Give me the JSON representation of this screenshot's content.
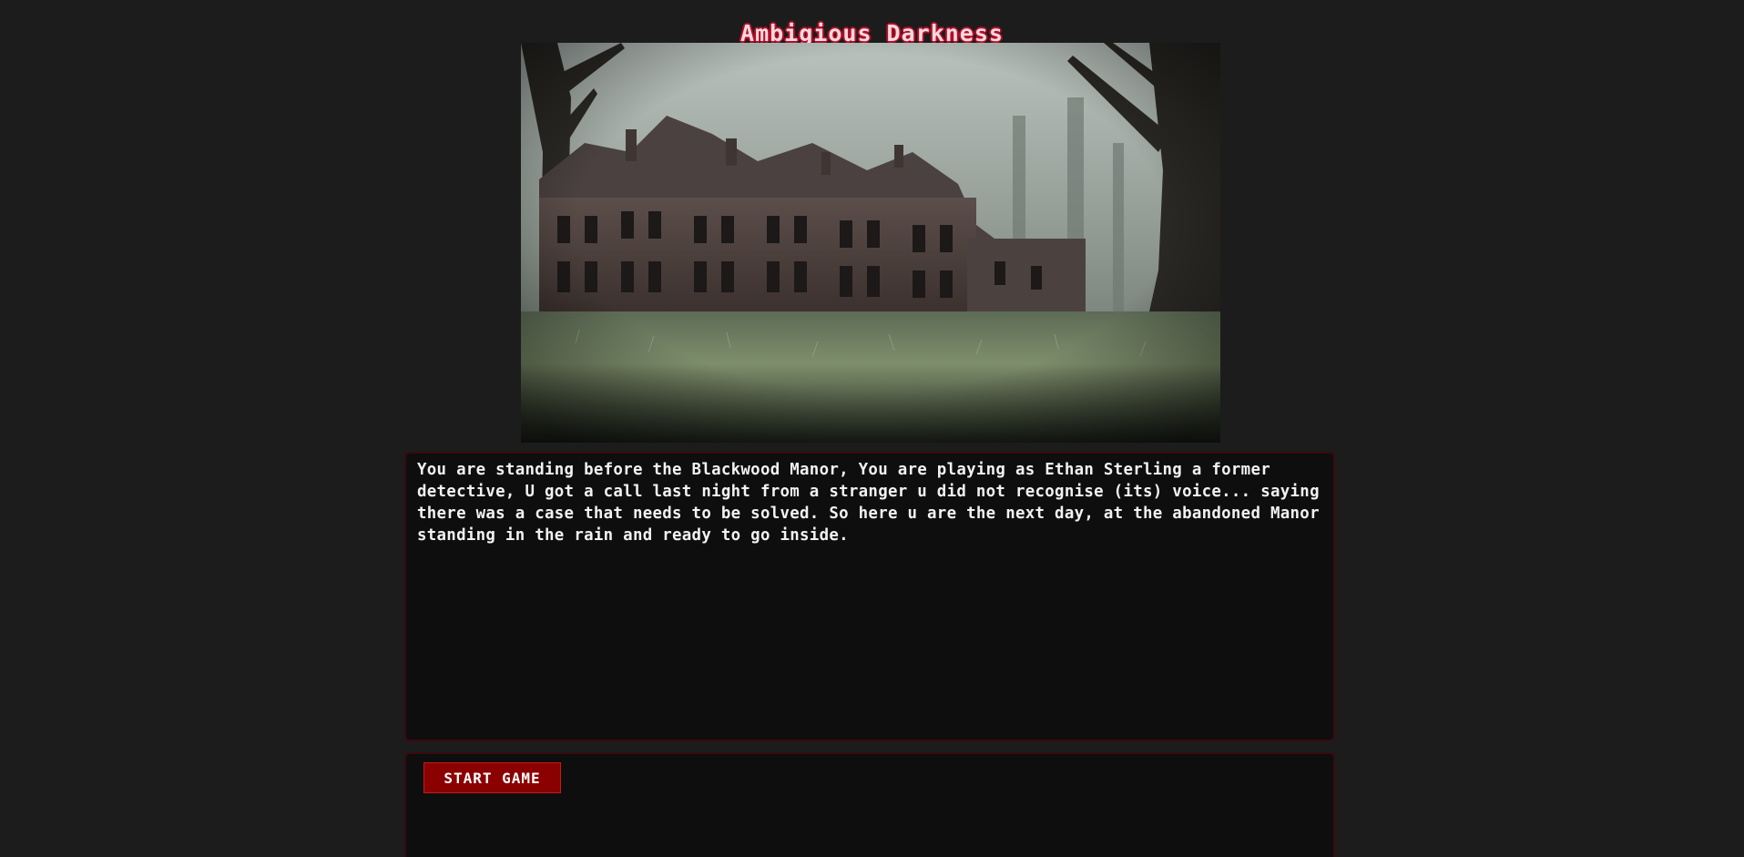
{
  "game": {
    "title": "Ambigious Darkness",
    "scene_image_alt": "Abandoned Blackwood Manor in a misty forest",
    "story_text": "You are standing before the Blackwood Manor, You are playing as Ethan Sterling a former detective, U got a call last night from a stranger u did not recognise (its) voice... saying there was a case that needs to be solved. So here u are the next day, at the abandoned Manor standing in the rain and ready to go inside."
  },
  "controls": {
    "start_label": "START GAME"
  },
  "colors": {
    "background": "#1c1c1c",
    "panel": "#0e0e0e",
    "panel_border": "#3a0a0f",
    "accent": "#8b0000",
    "title_outline": "#b0102a"
  }
}
